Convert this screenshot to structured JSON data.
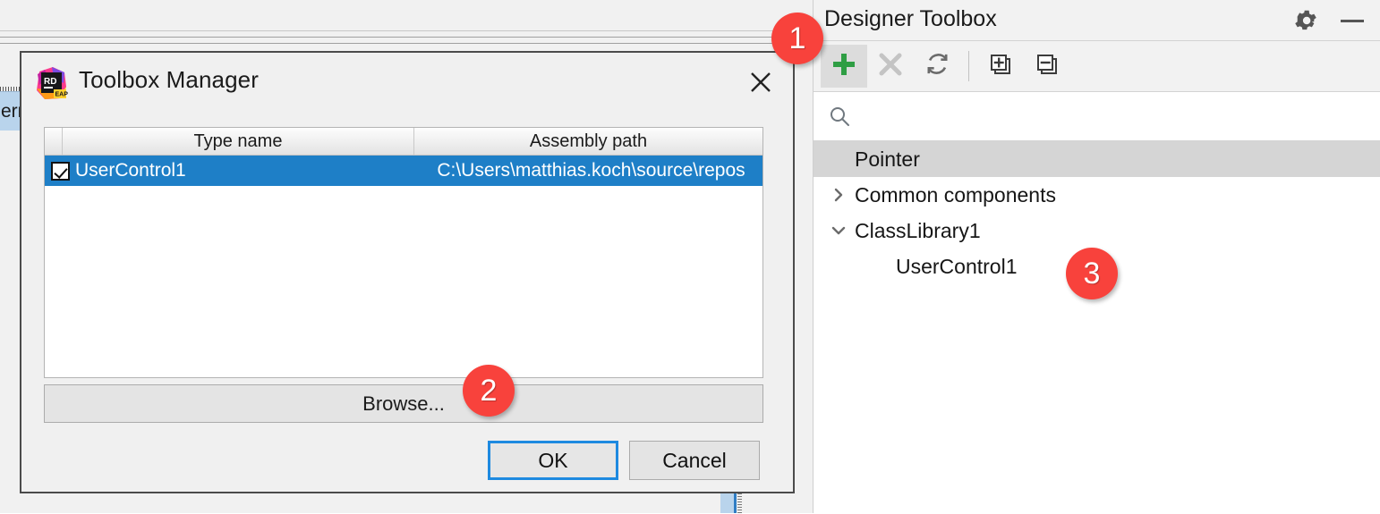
{
  "background": {
    "clipped_item_label": "ern"
  },
  "dialog": {
    "title": "Toolbox Manager",
    "app_icon": "rider-eap-icon",
    "close_icon": "close-icon",
    "grid": {
      "columns": [
        "",
        "Type name",
        "Assembly path"
      ],
      "rows": [
        {
          "checked": true,
          "type_name": "UserControl1",
          "assembly_path": "C:\\Users\\matthias.koch\\source\\repos"
        }
      ]
    },
    "browse_label": "Browse...",
    "ok_label": "OK",
    "cancel_label": "Cancel"
  },
  "toolwindow": {
    "title": "Designer Toolbox",
    "gear_icon": "gear-icon",
    "minimize_icon": "minimize-icon",
    "toolbar": [
      {
        "name": "add-item-button",
        "icon": "plus-icon",
        "state": "active"
      },
      {
        "name": "remove-item-button",
        "icon": "close-x-icon",
        "state": "disabled"
      },
      {
        "name": "refresh-button",
        "icon": "refresh-icon",
        "state": "enabled"
      },
      {
        "name": "expand-all-button",
        "icon": "expand-all-icon",
        "state": "enabled"
      },
      {
        "name": "collapse-all-button",
        "icon": "collapse-all-icon",
        "state": "enabled"
      }
    ],
    "search": {
      "value": "",
      "placeholder": "",
      "icon": "search-icon"
    },
    "tree": [
      {
        "label": "Pointer",
        "level": 1,
        "arrow": "none",
        "selected": true
      },
      {
        "label": "Common components",
        "level": 1,
        "arrow": "collapsed",
        "selected": false
      },
      {
        "label": "ClassLibrary1",
        "level": 1,
        "arrow": "expanded",
        "selected": false
      },
      {
        "label": "UserControl1",
        "level": 2,
        "arrow": "none",
        "selected": false
      }
    ]
  },
  "badges": [
    {
      "label": "1"
    },
    {
      "label": "2"
    },
    {
      "label": "3"
    }
  ],
  "colors": {
    "accent_blue": "#1e7fc7",
    "focus_blue": "#1e8ae0",
    "badge_red": "#f8423c",
    "plus_green": "#2f9e44"
  }
}
